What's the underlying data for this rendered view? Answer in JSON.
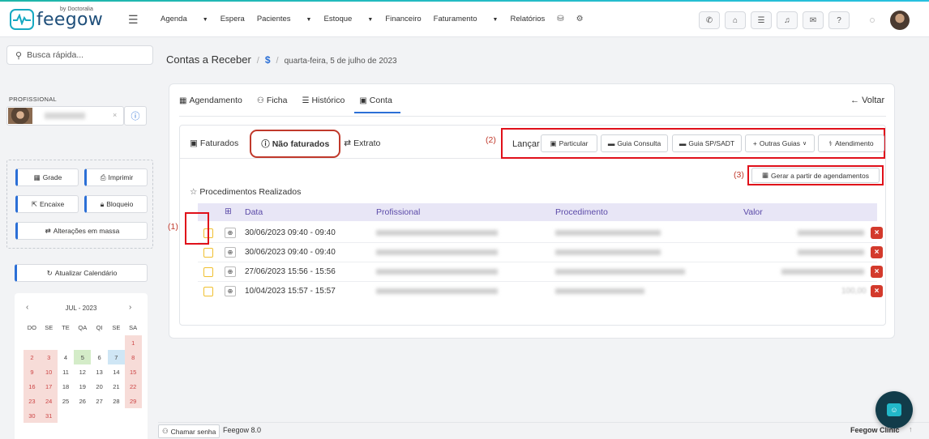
{
  "brand": {
    "name": "feegow",
    "by": "by Doctoralia"
  },
  "nav": {
    "items": [
      {
        "label": "Agenda",
        "caret": true
      },
      {
        "label": "Espera",
        "caret": false
      },
      {
        "label": "Pacientes",
        "caret": true
      },
      {
        "label": "Estoque",
        "caret": true
      },
      {
        "label": "Financeiro",
        "caret": false
      },
      {
        "label": "Faturamento",
        "caret": true
      },
      {
        "label": "Relatórios",
        "caret": false
      }
    ]
  },
  "sidebar": {
    "search_placeholder": "Busca rápida...",
    "professional_label": "PROFISSIONAL",
    "actions": {
      "grade": "Grade",
      "imprimir": "Imprimir",
      "encaixe": "Encaixe",
      "bloqueio": "Bloqueio",
      "alteracoes": "Alterações em massa"
    },
    "atualizar": "Atualizar Calendário",
    "calendar": {
      "month": "JUL - 2023",
      "dows": [
        "DO",
        "SE",
        "TE",
        "QA",
        "QI",
        "SE",
        "SA"
      ],
      "days": [
        {
          "d": "",
          "t": ""
        },
        {
          "d": "",
          "t": ""
        },
        {
          "d": "",
          "t": ""
        },
        {
          "d": "",
          "t": ""
        },
        {
          "d": "",
          "t": ""
        },
        {
          "d": "",
          "t": ""
        },
        {
          "d": "1",
          "t": "we"
        },
        {
          "d": "2",
          "t": "we"
        },
        {
          "d": "3",
          "t": "we"
        },
        {
          "d": "4",
          "t": ""
        },
        {
          "d": "5",
          "t": "green"
        },
        {
          "d": "6",
          "t": ""
        },
        {
          "d": "7",
          "t": "blue"
        },
        {
          "d": "8",
          "t": "we"
        },
        {
          "d": "9",
          "t": "we"
        },
        {
          "d": "10",
          "t": "we"
        },
        {
          "d": "11",
          "t": ""
        },
        {
          "d": "12",
          "t": ""
        },
        {
          "d": "13",
          "t": ""
        },
        {
          "d": "14",
          "t": ""
        },
        {
          "d": "15",
          "t": "we"
        },
        {
          "d": "16",
          "t": "we"
        },
        {
          "d": "17",
          "t": "we"
        },
        {
          "d": "18",
          "t": ""
        },
        {
          "d": "19",
          "t": ""
        },
        {
          "d": "20",
          "t": ""
        },
        {
          "d": "21",
          "t": ""
        },
        {
          "d": "22",
          "t": "we"
        },
        {
          "d": "23",
          "t": "we"
        },
        {
          "d": "24",
          "t": "we"
        },
        {
          "d": "25",
          "t": ""
        },
        {
          "d": "26",
          "t": ""
        },
        {
          "d": "27",
          "t": ""
        },
        {
          "d": "28",
          "t": ""
        },
        {
          "d": "29",
          "t": "we"
        },
        {
          "d": "30",
          "t": "we"
        },
        {
          "d": "31",
          "t": "we"
        }
      ]
    }
  },
  "breadcrumb": {
    "title": "Contas a Receber",
    "icon": "$",
    "date": "quarta-feira, 5 de julho de 2023"
  },
  "tabs": {
    "agendamento": "Agendamento",
    "ficha": "Ficha",
    "historico": "Histórico",
    "conta": "Conta",
    "voltar": "Voltar"
  },
  "inner_tabs": {
    "faturados": "Faturados",
    "nao_faturados": "Não faturados",
    "extrato": "Extrato"
  },
  "lancar": {
    "label": "Lançar",
    "particular": "Particular",
    "guia_consulta": "Guia Consulta",
    "guia_sp": "Guia SP/SADT",
    "outras": "Outras Guias",
    "atendimento": "Atendimento"
  },
  "annotations": {
    "n1": "(1)",
    "n2": "(2)",
    "n3": "(3)"
  },
  "gerar": "Gerar a partir de agendamentos",
  "section_title": "Procedimentos Realizados",
  "table": {
    "headers": {
      "data": "Data",
      "profissional": "Profissional",
      "procedimento": "Procedimento",
      "valor": "Valor"
    },
    "rows": [
      {
        "date": "30/06/2023 09:40 - 09:40",
        "valor": ""
      },
      {
        "date": "30/06/2023 09:40 - 09:40",
        "valor": ""
      },
      {
        "date": "27/06/2023 15:56 - 15:56",
        "valor": ""
      },
      {
        "date": "10/04/2023 15:57 - 15:57",
        "valor": "100,00"
      }
    ]
  },
  "footer": {
    "chamar": "Chamar senha",
    "version": "Feegow 8.0",
    "clinic": "Feegow Clinic"
  },
  "colors": {
    "accent": "#2b6fd6",
    "highlight": "#e0101a",
    "header_bg": "#e8e6f6",
    "delete": "#d33a2c"
  }
}
